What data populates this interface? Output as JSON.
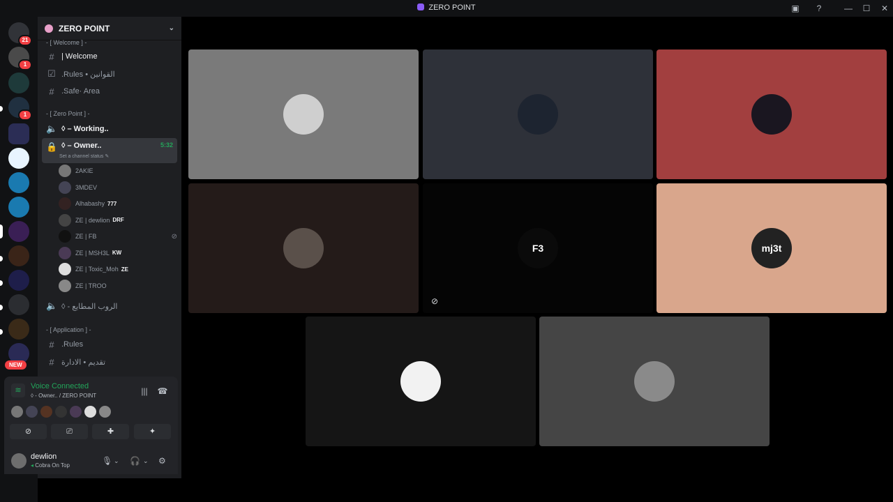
{
  "window": {
    "title": "ZERO POINT"
  },
  "rail": {
    "servers": [
      {
        "name": "discord-home",
        "badge": "21",
        "color": "#313338"
      },
      {
        "name": "server-2",
        "badge": "1",
        "color": "#4a4a4a"
      },
      {
        "name": "server-3",
        "badge": "",
        "color": "#1e3a3a"
      },
      {
        "name": "server-4",
        "badge": "1",
        "color": "#203040"
      },
      {
        "name": "folder",
        "badge": "",
        "color": "#2b2d55"
      },
      {
        "name": "server-crown",
        "badge": "",
        "color": "#e8f4ff"
      },
      {
        "name": "server-tc",
        "badge": "",
        "color": "#1a7ab0"
      },
      {
        "name": "server-tcv",
        "badge": "",
        "color": "#1a7ab0"
      },
      {
        "name": "server-purple",
        "badge": "",
        "color": "#3a1f55"
      },
      {
        "name": "server-orange",
        "badge": "",
        "color": "#3a2418"
      },
      {
        "name": "server-v",
        "badge": "",
        "color": "#1e1e4a"
      },
      {
        "name": "server-orange2",
        "badge": "",
        "color": "#2b2d31"
      },
      {
        "name": "server-brown",
        "badge": "",
        "color": "#3a2a18"
      },
      {
        "name": "server-shield",
        "badge": "",
        "color": "#2a2a55"
      }
    ],
    "new_label": "NEW"
  },
  "sidebar": {
    "server_name": "ZERO POINT",
    "cat_welcome": "- [ Welcome ] -",
    "ch_welcome": "| Welcome",
    "ch_rules": ".Rules • القوانين",
    "ch_safe": ".Safe· Area",
    "cat_zero": "- [ Zero Point ] -",
    "ch_working": "◊ – Working..",
    "ch_owner": "◊ – Owner..",
    "owner_time": "5:32",
    "owner_status": "Set a channel status",
    "voice_users": [
      {
        "name": "2AKIE",
        "tag": "",
        "color": "#777"
      },
      {
        "name": "3MDEV",
        "tag": "",
        "color": "#445"
      },
      {
        "name": "Alhabashy",
        "tag": "777",
        "color": "#332222"
      },
      {
        "name": "ZE | dewlion",
        "tag": "DRF",
        "color": "#444"
      },
      {
        "name": "ZE | FB",
        "tag": "",
        "color": "#111"
      },
      {
        "name": "ZE | MSH3L",
        "tag": "KW",
        "color": "#4a3a55"
      },
      {
        "name": "ZE | Toxic_Moh",
        "tag": "ZE",
        "color": "#ddd"
      },
      {
        "name": "ZE | TROO",
        "tag": "",
        "color": "#888"
      }
    ],
    "ch_arabic": "◊ - الروب المطايع",
    "cat_application": "- [ Application ] -",
    "ch_app_rules": ".Rules",
    "ch_app_arabic": "تقديم • الادارة"
  },
  "voice_panel": {
    "title": "Voice Connected",
    "subtitle": "◊ - Owner.. / ZERO POINT"
  },
  "user": {
    "name": "dewlion",
    "status": "Cobra On Top"
  },
  "tiles": [
    {
      "bg": "#7a7a7a",
      "avatar_color": "#cfcfcf",
      "label": ""
    },
    {
      "bg": "#2e3139",
      "avatar_color": "#1d2430",
      "label": ""
    },
    {
      "bg": "#a23f3f",
      "avatar_color": "#1a1620",
      "label": ""
    },
    {
      "bg": "#241b19",
      "avatar_color": "#5a504a",
      "label": ""
    },
    {
      "bg": "#050505",
      "avatar_color": "#0a0a0a",
      "label": "F3"
    },
    {
      "bg": "#d9a68c",
      "avatar_color": "#222",
      "label": "mj3t"
    },
    {
      "bg": "#151515",
      "avatar_color": "#f2f2f2",
      "label": ""
    },
    {
      "bg": "#454545",
      "avatar_color": "#8a8a8a",
      "label": ""
    }
  ]
}
